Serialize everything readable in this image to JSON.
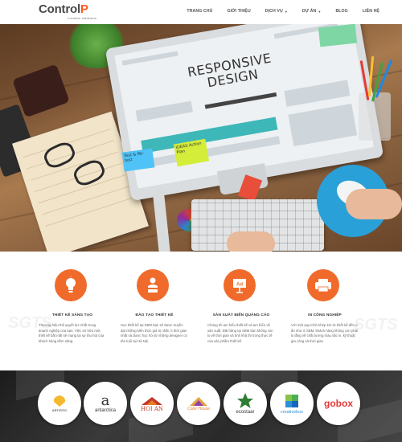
{
  "header": {
    "logo_text": "Control",
    "logo_accent": "P",
    "logo_subtitle": "creative solutions",
    "nav": [
      {
        "label": "TRANG CHỦ",
        "has_dropdown": false
      },
      {
        "label": "GIỚI THIỆU",
        "has_dropdown": false
      },
      {
        "label": "DỊCH VỤ",
        "has_dropdown": true
      },
      {
        "label": "DỰ ÁN",
        "has_dropdown": true
      },
      {
        "label": "BLOG",
        "has_dropdown": false
      },
      {
        "label": "LIÊN HỆ",
        "has_dropdown": false
      }
    ]
  },
  "hero": {
    "screen_title_line1": "RESPONSIVE",
    "screen_title_line2": "DESIGN",
    "sticky_note_1": "Test & Re-test",
    "sticky_note_2": "IDEAS Action Plan"
  },
  "services": [
    {
      "icon": "lightbulb-icon",
      "title": "THIẾT KẾ SÁNG TẠO",
      "text": "Thương hiệu thể quyết lực nhất trong doanh nghiệp của bạn. Việc sở hữu một thiết kế bắt mắt sẽ mang lại sự thu hút của khách hàng tiềm năng."
    },
    {
      "icon": "presenter-icon",
      "title": "ĐÀO TẠO THIẾT KẾ",
      "text": "Học thiết kế tại SBM bạn sẽ được truyền đạt những kiến thức giá trị nhất, ít thời gian nhất và được học hỏi từ những designer có tên tuổi tại Hà Nội."
    },
    {
      "icon": "ad-sign-icon",
      "title": "SẢN XUẤT BIỂN QUẢNG CÁO",
      "text": "Chúng tôi am hiểu thiết kế và am hiểu về sản xuất. Đặt hàng tại SBM bạn không còn lo về thời gian và tính khả thi trong thực tế của sản phẩm thiết kế."
    },
    {
      "icon": "printer-icon",
      "title": "IN CÔNG NGHIỆP",
      "text": "Với một quy trình khép kín từ thiết kế đến in ấn như ở SBM, khách hàng không còn phải lo lắng về chất lượng màu sắc in, kỹ thuật gia công và thời gian."
    }
  ],
  "clients": [
    {
      "name": "ARTISTIC",
      "color": "#f5b82e"
    },
    {
      "name": "antarctica",
      "color": "#333333"
    },
    {
      "name": "HOI AN",
      "color": "#c0392b"
    },
    {
      "name": "Color House",
      "color": "#e6a23c"
    },
    {
      "name": "ecostaar",
      "color": "#2e7d32"
    },
    {
      "name": "creativebox",
      "color": "#2b8fd6"
    },
    {
      "name": "gobox",
      "color": "#e53935"
    }
  ],
  "colors": {
    "accent": "#f06b2b",
    "text": "#333333"
  }
}
